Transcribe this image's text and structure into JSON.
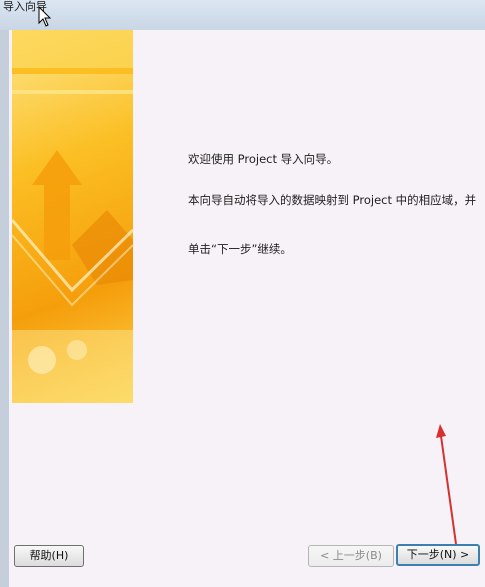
{
  "window": {
    "title": "导入向导"
  },
  "content": {
    "welcome": "欢迎使用 Project 导入向导。",
    "description": "本向导自动将导入的数据映射到 Project 中的相应域，并",
    "instruction": "单击“下一步”继续。"
  },
  "buttons": {
    "help": "帮助(H)",
    "back": "< 上一步(B)",
    "next": "下一步(N) >"
  },
  "colors": {
    "banner_light": "#fde68a",
    "banner_dark": "#f59e0b",
    "annotation_arrow": "#d63031",
    "focus_border": "#3c7fb1"
  }
}
